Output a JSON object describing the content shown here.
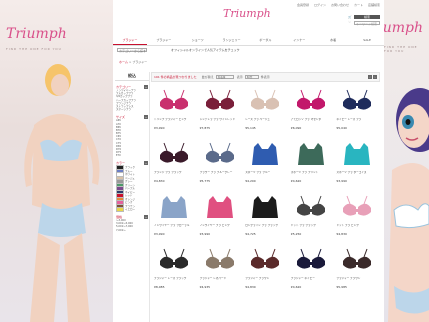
{
  "brand": {
    "logo": "Triumph"
  },
  "side_left": {
    "script": "Triumph",
    "tagline": "FIND THE ONE FOR YOU"
  },
  "side_right": {
    "script": "Triumph",
    "tagline": "FIND THE ONE FOR YOU"
  },
  "utility_links": [
    "会員登録",
    "ログイン",
    "お問い合わせ",
    "カート",
    "店舗検索"
  ],
  "header": {
    "search_button": "検索",
    "keyword_placeholder": "キーワード検索"
  },
  "nav": [
    {
      "label": "ブラジャー",
      "active": true
    },
    {
      "label": "ブラジャー",
      "active": false
    },
    {
      "label": "ショーツ",
      "active": false
    },
    {
      "label": "ランジェリー",
      "active": false
    },
    {
      "label": "ボーダル",
      "active": false
    },
    {
      "label": "インナー",
      "active": false
    },
    {
      "label": "水着",
      "active": false
    },
    {
      "label": "SALE",
      "active": false
    }
  ],
  "subbar": {
    "select": "カテゴリーから探す",
    "promo": "オフィシャルオンラインで人気アイテムをチェック"
  },
  "breadcrumb": {
    "home": "ホーム",
    "current": "ブラジャー"
  },
  "filter": {
    "title": "絞込",
    "sections": [
      {
        "label": "カテゴリー",
        "options": [
          "ノンワイヤーブラ",
          "フルカップブラ",
          "3/4カップブラ",
          "ハーフカップブラ",
          "プランジブラ",
          "ストラップレス",
          "スポーツブラ"
        ]
      },
      {
        "label": "サイズ",
        "options": [
          "A65",
          "A70",
          "B65",
          "B70",
          "B75",
          "C65",
          "C70",
          "C75",
          "D65",
          "D70",
          "D75",
          "E70"
        ]
      },
      {
        "label": "カラー",
        "colors": [
          {
            "name": "ブラック",
            "hex": "#222222"
          },
          {
            "name": "ブルー",
            "hex": "#6c7ec4"
          },
          {
            "name": "ホワイト",
            "hex": "#ffffff"
          },
          {
            "name": "ベージュ",
            "hex": "#d8c2a8"
          },
          {
            "name": "グレー",
            "hex": "#999999"
          },
          {
            "name": "グリーン",
            "hex": "#4d9a6a"
          },
          {
            "name": "パープル",
            "hex": "#7b4a8c"
          },
          {
            "name": "ネイビー",
            "hex": "#2c3a6a"
          },
          {
            "name": "レッド",
            "hex": "#c8102e"
          },
          {
            "name": "オレンジ",
            "hex": "#e58a3a"
          },
          {
            "name": "ピンク",
            "hex": "#e5619c"
          },
          {
            "name": "ブラウン",
            "hex": "#7a4f3a"
          },
          {
            "name": "イエロー",
            "hex": "#e8d64a"
          }
        ]
      },
      {
        "label": "価格",
        "options": [
          "〜3,000",
          "3,001〜5,000",
          "5,001〜7,000",
          "7,001〜"
        ]
      }
    ]
  },
  "results": {
    "count_text": "191 件の商品が見つかりました",
    "sort_label": "並び替え",
    "sort_value": "新着順",
    "per_page_label": "表示",
    "per_page_value": "60件",
    "per_page_suffix": "件表示"
  },
  "products": [
    {
      "name": "トリンプ ブラジャー ピンク",
      "price": "¥3,990",
      "color": "#c9306e",
      "style": "bra"
    },
    {
      "name": "シンデレラ ブラ ワインレッド",
      "price": "¥7,875",
      "color": "#7a1f3a",
      "style": "bra"
    },
    {
      "name": "レース ブラ ベージュ",
      "price": "¥5,145",
      "color": "#d9c1b3",
      "style": "bra"
    },
    {
      "name": "アモロッソ ブラ マゼンタ",
      "price": "¥6,090",
      "color": "#c2186b",
      "style": "bra"
    },
    {
      "name": "ネイビー レース ブラ",
      "price": "¥5,040",
      "color": "#1f2c5c",
      "style": "bra"
    },
    {
      "name": "プランジ ブラ ブラック",
      "price": "¥4,830",
      "color": "#3a1a2a",
      "style": "bra"
    },
    {
      "name": "フラワー ブラ ブルーグレー",
      "price": "¥5,775",
      "color": "#5a6a8a",
      "style": "bra"
    },
    {
      "name": "スポーツ ブラ ブルー",
      "price": "¥4,200",
      "color": "#2f5cb0",
      "style": "sport"
    },
    {
      "name": "スポーツ ブラ プリント",
      "price": "¥4,620",
      "color": "#3d6a5a",
      "style": "sport"
    },
    {
      "name": "スポーツ ブラ ターコイズ",
      "price": "¥3,990",
      "color": "#29b5c0",
      "style": "sport"
    },
    {
      "name": "ノンワイヤー ブラ フローラル",
      "price": "¥3,990",
      "color": "#8aa4c8",
      "style": "sport"
    },
    {
      "name": "ノンワイヤー ブラ ピンク",
      "price": "¥3,990",
      "color": "#e05080",
      "style": "sport"
    },
    {
      "name": "ロングライン ブラ ブラック",
      "price": "¥4,725",
      "color": "#1c1c1c",
      "style": "sport"
    },
    {
      "name": "ドット ブラ ブラック",
      "price": "¥5,250",
      "color": "#444444",
      "style": "bra"
    },
    {
      "name": "ドット ブラ ピンク",
      "price": "¥4,830",
      "color": "#e8a0b8",
      "style": "bra"
    },
    {
      "name": "ブラジャー レース ブラック",
      "price": "¥8,085",
      "color": "#2a2a2a",
      "style": "bra"
    },
    {
      "name": "ブラジャー レオパード",
      "price": "¥4,935",
      "color": "#8a7a6a",
      "style": "bra"
    },
    {
      "name": "ブラジャー ブラウン",
      "price": "¥4,830",
      "color": "#5a2a2a",
      "style": "bra"
    },
    {
      "name": "ブラジャー ネイビー",
      "price": "¥4,620",
      "color": "#1a1a3a",
      "style": "bra"
    },
    {
      "name": "ブラジャー ブラウン",
      "price": "¥5,985",
      "color": "#3a2a2a",
      "style": "bra"
    }
  ]
}
